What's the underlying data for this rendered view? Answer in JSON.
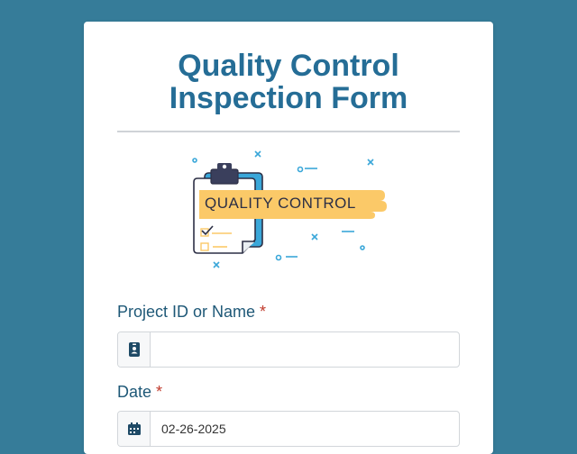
{
  "form": {
    "title_line1": "Quality Control",
    "title_line2": "Inspection Form",
    "banner_text": "QUALITY CONTROL",
    "fields": [
      {
        "label": "Project ID or Name",
        "required_mark": "*",
        "value": "",
        "icon": "id-badge-icon"
      },
      {
        "label": "Date",
        "required_mark": "*",
        "value": "02-26-2025",
        "icon": "calendar-icon"
      }
    ]
  },
  "colors": {
    "background": "#367c99",
    "title": "#256d96",
    "label": "#1e5877",
    "required": "#c0392b",
    "banner": "#fbc968",
    "accent_blue": "#3aa7d9"
  }
}
